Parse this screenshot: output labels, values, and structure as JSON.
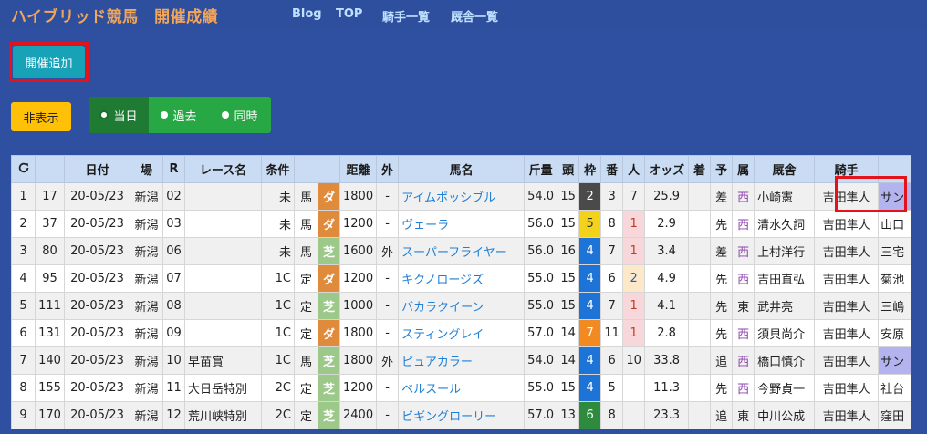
{
  "header": {
    "brand": "ハイブリッド競馬　開催成績",
    "nav": [
      "Blog",
      "TOP",
      "騎手一覧",
      "厩舎一覧"
    ]
  },
  "buttons": {
    "add": "開催追加",
    "hide": "非表示"
  },
  "radio": {
    "options": [
      "当日",
      "過去",
      "同時"
    ],
    "selected": "当日"
  },
  "table": {
    "refresh_icon": "refresh-icon",
    "headers": [
      "",
      "",
      "日付",
      "場",
      "R",
      "レース名",
      "条件",
      "",
      "",
      "距離",
      "外",
      "馬名",
      "斤量",
      "頭",
      "枠",
      "番",
      "人",
      "オッズ",
      "着",
      "予",
      "属",
      "厩舎",
      "騎手",
      ""
    ],
    "rows": [
      {
        "no": "1",
        "id": "17",
        "date": "20-05/23",
        "track": "新潟",
        "race": "02",
        "name": "",
        "cls": "未",
        "cond": "馬",
        "surface": "ダ",
        "dist": "1800",
        "out": "-",
        "horse": "アイムポッシブル",
        "weight": "54.0",
        "heads": "15",
        "waku": "2",
        "ban": "3",
        "pop": "7",
        "odds": "25.9",
        "rank": "",
        "pred": "差",
        "aff": "西",
        "trainer": "小崎憲",
        "jockey": "吉田隼人",
        "last": "サン"
      },
      {
        "no": "2",
        "id": "37",
        "date": "20-05/23",
        "track": "新潟",
        "race": "03",
        "name": "",
        "cls": "未",
        "cond": "馬",
        "surface": "ダ",
        "dist": "1200",
        "out": "-",
        "horse": "ヴェーラ",
        "weight": "56.0",
        "heads": "15",
        "waku": "5",
        "ban": "8",
        "pop": "1",
        "odds": "2.9",
        "rank": "",
        "pred": "先",
        "aff": "西",
        "trainer": "清水久詞",
        "jockey": "吉田隼人",
        "last": "山口"
      },
      {
        "no": "3",
        "id": "80",
        "date": "20-05/23",
        "track": "新潟",
        "race": "06",
        "name": "",
        "cls": "未",
        "cond": "馬",
        "surface": "芝",
        "dist": "1600",
        "out": "外",
        "horse": "スーパーフライヤー",
        "weight": "56.0",
        "heads": "16",
        "waku": "4",
        "ban": "7",
        "pop": "1",
        "odds": "3.4",
        "rank": "",
        "pred": "差",
        "aff": "西",
        "trainer": "上村洋行",
        "jockey": "吉田隼人",
        "last": "三宅"
      },
      {
        "no": "4",
        "id": "95",
        "date": "20-05/23",
        "track": "新潟",
        "race": "07",
        "name": "",
        "cls": "1C",
        "cond": "定",
        "surface": "ダ",
        "dist": "1200",
        "out": "-",
        "horse": "キクノロージズ",
        "weight": "55.0",
        "heads": "15",
        "waku": "4",
        "ban": "6",
        "pop": "2",
        "odds": "4.9",
        "rank": "",
        "pred": "先",
        "aff": "西",
        "trainer": "吉田直弘",
        "jockey": "吉田隼人",
        "last": "菊池"
      },
      {
        "no": "5",
        "id": "111",
        "date": "20-05/23",
        "track": "新潟",
        "race": "08",
        "name": "",
        "cls": "1C",
        "cond": "定",
        "surface": "芝",
        "dist": "1000",
        "out": "-",
        "horse": "バカラクイーン",
        "weight": "55.0",
        "heads": "15",
        "waku": "4",
        "ban": "7",
        "pop": "1",
        "odds": "4.1",
        "rank": "",
        "pred": "先",
        "aff": "東",
        "trainer": "武井亮",
        "jockey": "吉田隼人",
        "last": "三嶋"
      },
      {
        "no": "6",
        "id": "131",
        "date": "20-05/23",
        "track": "新潟",
        "race": "09",
        "name": "",
        "cls": "1C",
        "cond": "定",
        "surface": "ダ",
        "dist": "1800",
        "out": "-",
        "horse": "スティングレイ",
        "weight": "57.0",
        "heads": "14",
        "waku": "7",
        "ban": "11",
        "pop": "1",
        "odds": "2.8",
        "rank": "",
        "pred": "先",
        "aff": "西",
        "trainer": "須貝尚介",
        "jockey": "吉田隼人",
        "last": "安原"
      },
      {
        "no": "7",
        "id": "140",
        "date": "20-05/23",
        "track": "新潟",
        "race": "10",
        "name": "早苗賞",
        "cls": "1C",
        "cond": "馬",
        "surface": "芝",
        "dist": "1800",
        "out": "外",
        "horse": "ピュアカラー",
        "weight": "54.0",
        "heads": "14",
        "waku": "4",
        "ban": "6",
        "pop": "10",
        "odds": "33.8",
        "rank": "",
        "pred": "追",
        "aff": "西",
        "trainer": "橋口慎介",
        "jockey": "吉田隼人",
        "last": "サン"
      },
      {
        "no": "8",
        "id": "155",
        "date": "20-05/23",
        "track": "新潟",
        "race": "11",
        "name": "大日岳特別",
        "cls": "2C",
        "cond": "定",
        "surface": "芝",
        "dist": "1200",
        "out": "-",
        "horse": "ベルスール",
        "weight": "55.0",
        "heads": "15",
        "waku": "4",
        "ban": "5",
        "pop": "",
        "odds": "11.3",
        "rank": "",
        "pred": "先",
        "aff": "西",
        "trainer": "今野貞一",
        "jockey": "吉田隼人",
        "last": "社台"
      },
      {
        "no": "9",
        "id": "170",
        "date": "20-05/23",
        "track": "新潟",
        "race": "12",
        "name": "荒川峡特別",
        "cls": "2C",
        "cond": "定",
        "surface": "芝",
        "dist": "2400",
        "out": "-",
        "horse": "ビギングローリー",
        "weight": "57.0",
        "heads": "13",
        "waku": "6",
        "ban": "8",
        "pop": "",
        "odds": "23.3",
        "rank": "",
        "pred": "追",
        "aff": "東",
        "trainer": "中川公成",
        "jockey": "吉田隼人",
        "last": "窪田"
      }
    ]
  },
  "colors": {
    "waku2": "#4a4a4a",
    "waku4": "#1e73d6",
    "waku5": "#f2d21b",
    "waku6": "#2e8b3e",
    "waku7": "#f28a22",
    "dirt": "#e08a3c",
    "turf": "#9cc88a"
  }
}
